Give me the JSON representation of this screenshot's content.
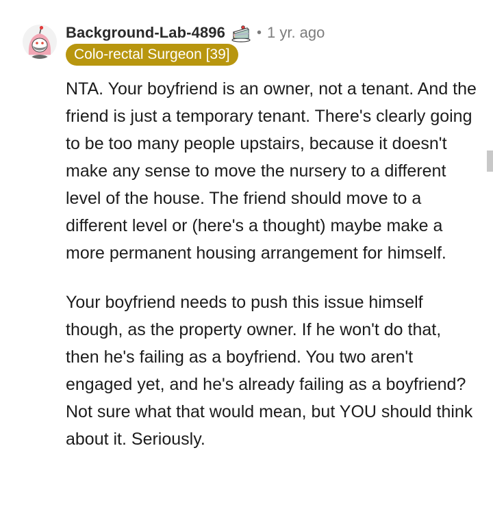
{
  "comment": {
    "author": "Background-Lab-4896",
    "separator": "•",
    "age": "1 yr. ago",
    "flair": "Colo-rectal Surgeon [39]",
    "paragraphs": [
      "NTA. Your boyfriend is an owner, not a tenant. And the friend is just a temporary tenant. There's clearly going to be too many people upstairs, because it doesn't make any sense to move the nursery to a different level of the house. The friend should move to a different level or (here's a thought) maybe make a more permanent housing arrangement for himself.",
      "Your boyfriend needs to push this issue himself though, as the property owner. If he won't do that, then he's failing as a boyfriend. You two aren't engaged yet, and he's already failing as a boyfriend? Not sure what that would mean, but YOU should think about it. Seriously."
    ]
  },
  "icons": {
    "avatar": "snoo-avatar",
    "cake_day": "cake-icon"
  },
  "colors": {
    "flair_bg": "#b8960f",
    "flair_text": "#ffffff",
    "meta_text": "#7c7c7c",
    "body_text": "#1c1c1c"
  }
}
